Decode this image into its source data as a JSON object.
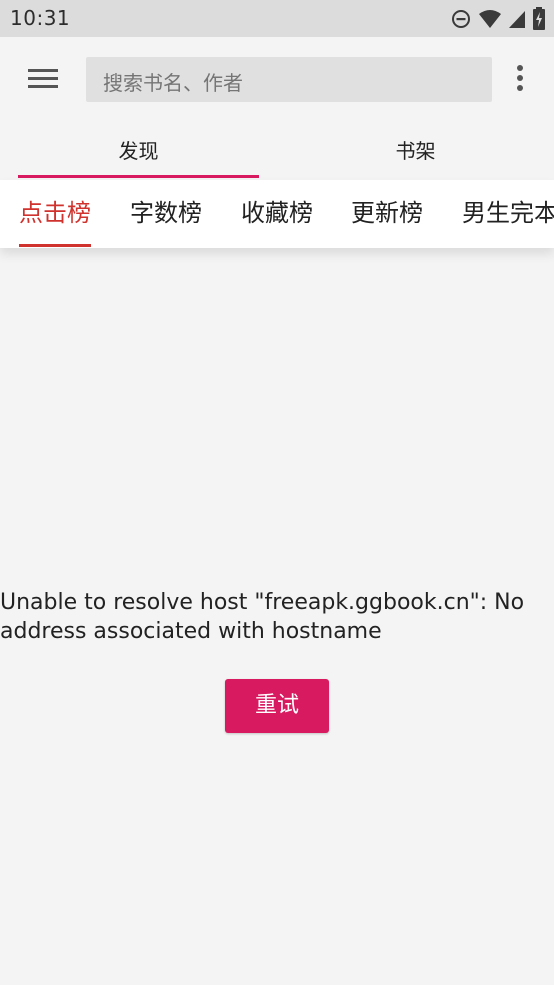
{
  "status_bar": {
    "time": "10:31",
    "icons": [
      "do-not-disturb-icon",
      "wifi-icon",
      "signal-icon",
      "battery-charging-icon"
    ]
  },
  "app_bar": {
    "menu_icon": "hamburger-menu-icon",
    "search_placeholder": "搜索书名、作者",
    "more_icon": "more-vert-icon"
  },
  "main_tabs": [
    {
      "label": "发现",
      "selected": true
    },
    {
      "label": "书架",
      "selected": false
    }
  ],
  "sub_tabs": [
    {
      "label": "点击榜",
      "selected": true
    },
    {
      "label": "字数榜",
      "selected": false
    },
    {
      "label": "收藏榜",
      "selected": false
    },
    {
      "label": "更新榜",
      "selected": false
    },
    {
      "label": "男生完本",
      "selected": false
    }
  ],
  "error": {
    "message": "Unable to resolve host \"freeapk.ggbook.cn\": No address associated with hostname",
    "retry_label": "重试"
  },
  "colors": {
    "accent": "#d81b60",
    "sub_tab_active": "#d0332e",
    "status_bar_bg": "#dcdcdc",
    "page_bg": "#f4f4f4"
  }
}
